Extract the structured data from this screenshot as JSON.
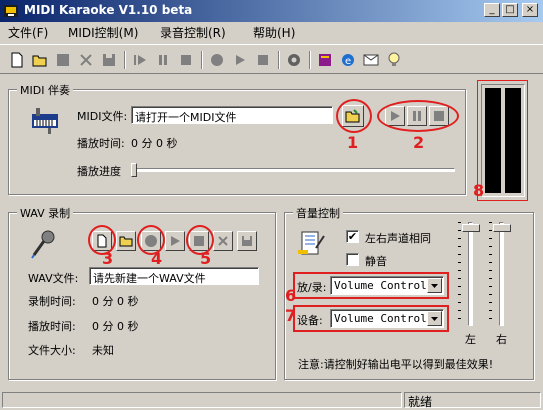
{
  "window": {
    "title": "MIDI Karaoke V1.10 beta"
  },
  "menu": [
    "文件(F)",
    "MIDI控制(M)",
    "录音控制(R)",
    "帮助(H)"
  ],
  "midi": {
    "legend": "MIDI 伴奏",
    "file_label": "MIDI文件:",
    "file_value": "请打开一个MIDI文件",
    "time_label": "播放时间:",
    "time_value": "0 分 0 秒",
    "progress_label": "播放进度"
  },
  "wav": {
    "legend": "WAV 录制",
    "file_label": "WAV文件:",
    "file_value": "请先新建一个WAV文件",
    "rec_time_label": "录制时间:",
    "rec_time_value": "0 分 0 秒",
    "play_time_label": "播放时间:",
    "play_time_value": "0 分 0 秒",
    "size_label": "文件大小:",
    "size_value": "未知"
  },
  "volume": {
    "legend": "音量控制",
    "same_lr_label": "左右声道相同",
    "same_lr_checked": true,
    "mute_label": "静音",
    "mute_checked": false,
    "play_rec_label": "放/录:",
    "play_rec_value": "Volume Control",
    "device_label": "设备:",
    "device_value": "Volume Control",
    "left_label": "左",
    "right_label": "右",
    "note": "注意:请控制好输出电平以得到最佳效果!"
  },
  "annotations": [
    "1",
    "2",
    "3",
    "4",
    "5",
    "6",
    "7",
    "8"
  ],
  "status": {
    "text": "就绪"
  },
  "colors": {
    "title_start": "#0a246a",
    "title_end": "#a6caf0",
    "annotation": "#e02020"
  }
}
